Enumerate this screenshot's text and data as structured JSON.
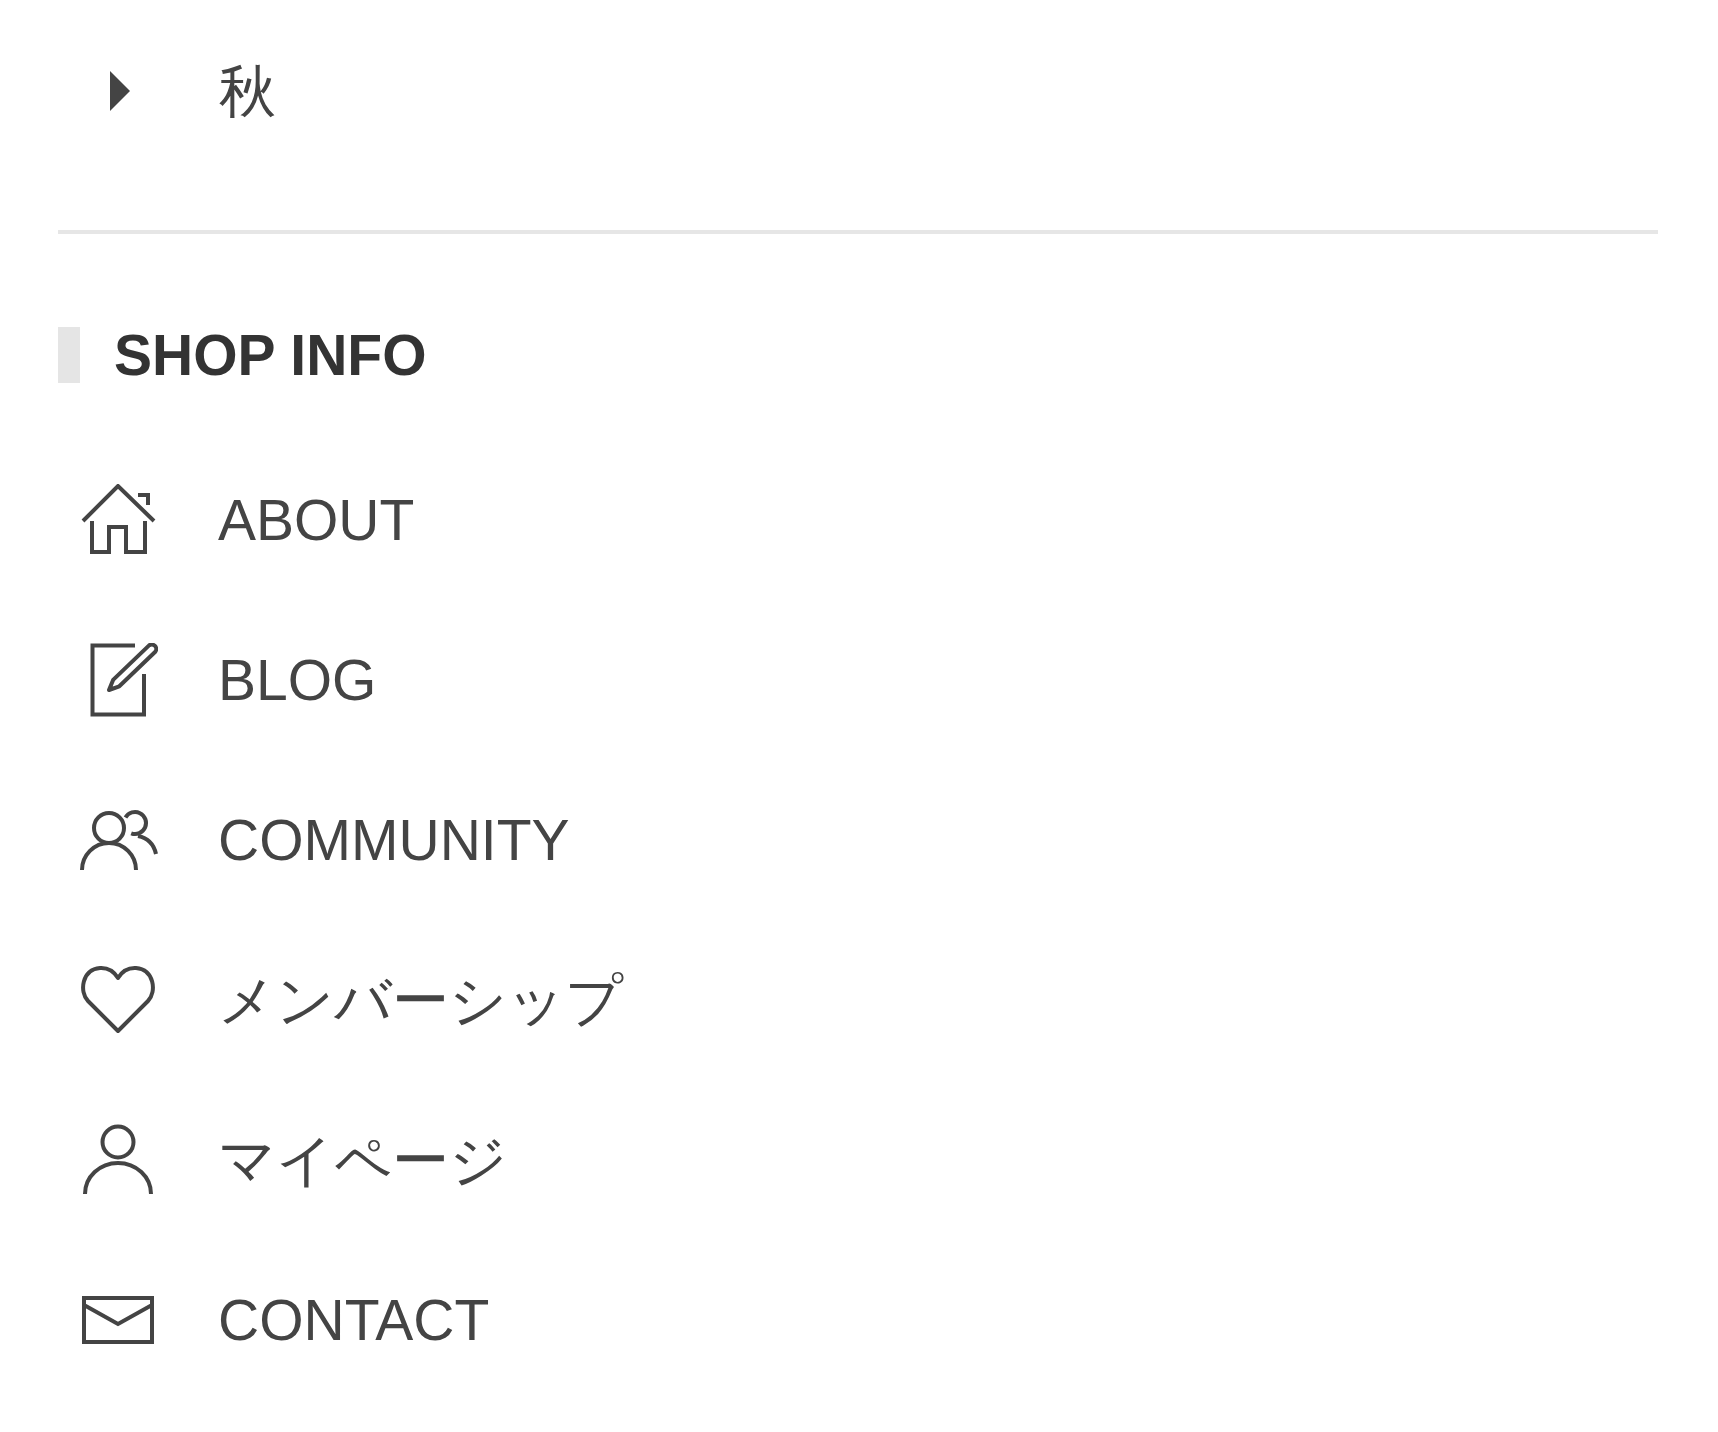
{
  "category_list": {
    "items": [
      {
        "label": "秋",
        "expanded": false
      }
    ]
  },
  "shop_info": {
    "heading": "SHOP INFO",
    "links": [
      {
        "kind": "home",
        "label": "ABOUT"
      },
      {
        "kind": "blog",
        "label": "BLOG"
      },
      {
        "kind": "community",
        "label": "COMMUNITY"
      },
      {
        "kind": "favorite",
        "label": "メンバーシップ"
      },
      {
        "kind": "account",
        "label": "マイページ"
      },
      {
        "kind": "mail",
        "label": "CONTACT"
      }
    ]
  }
}
